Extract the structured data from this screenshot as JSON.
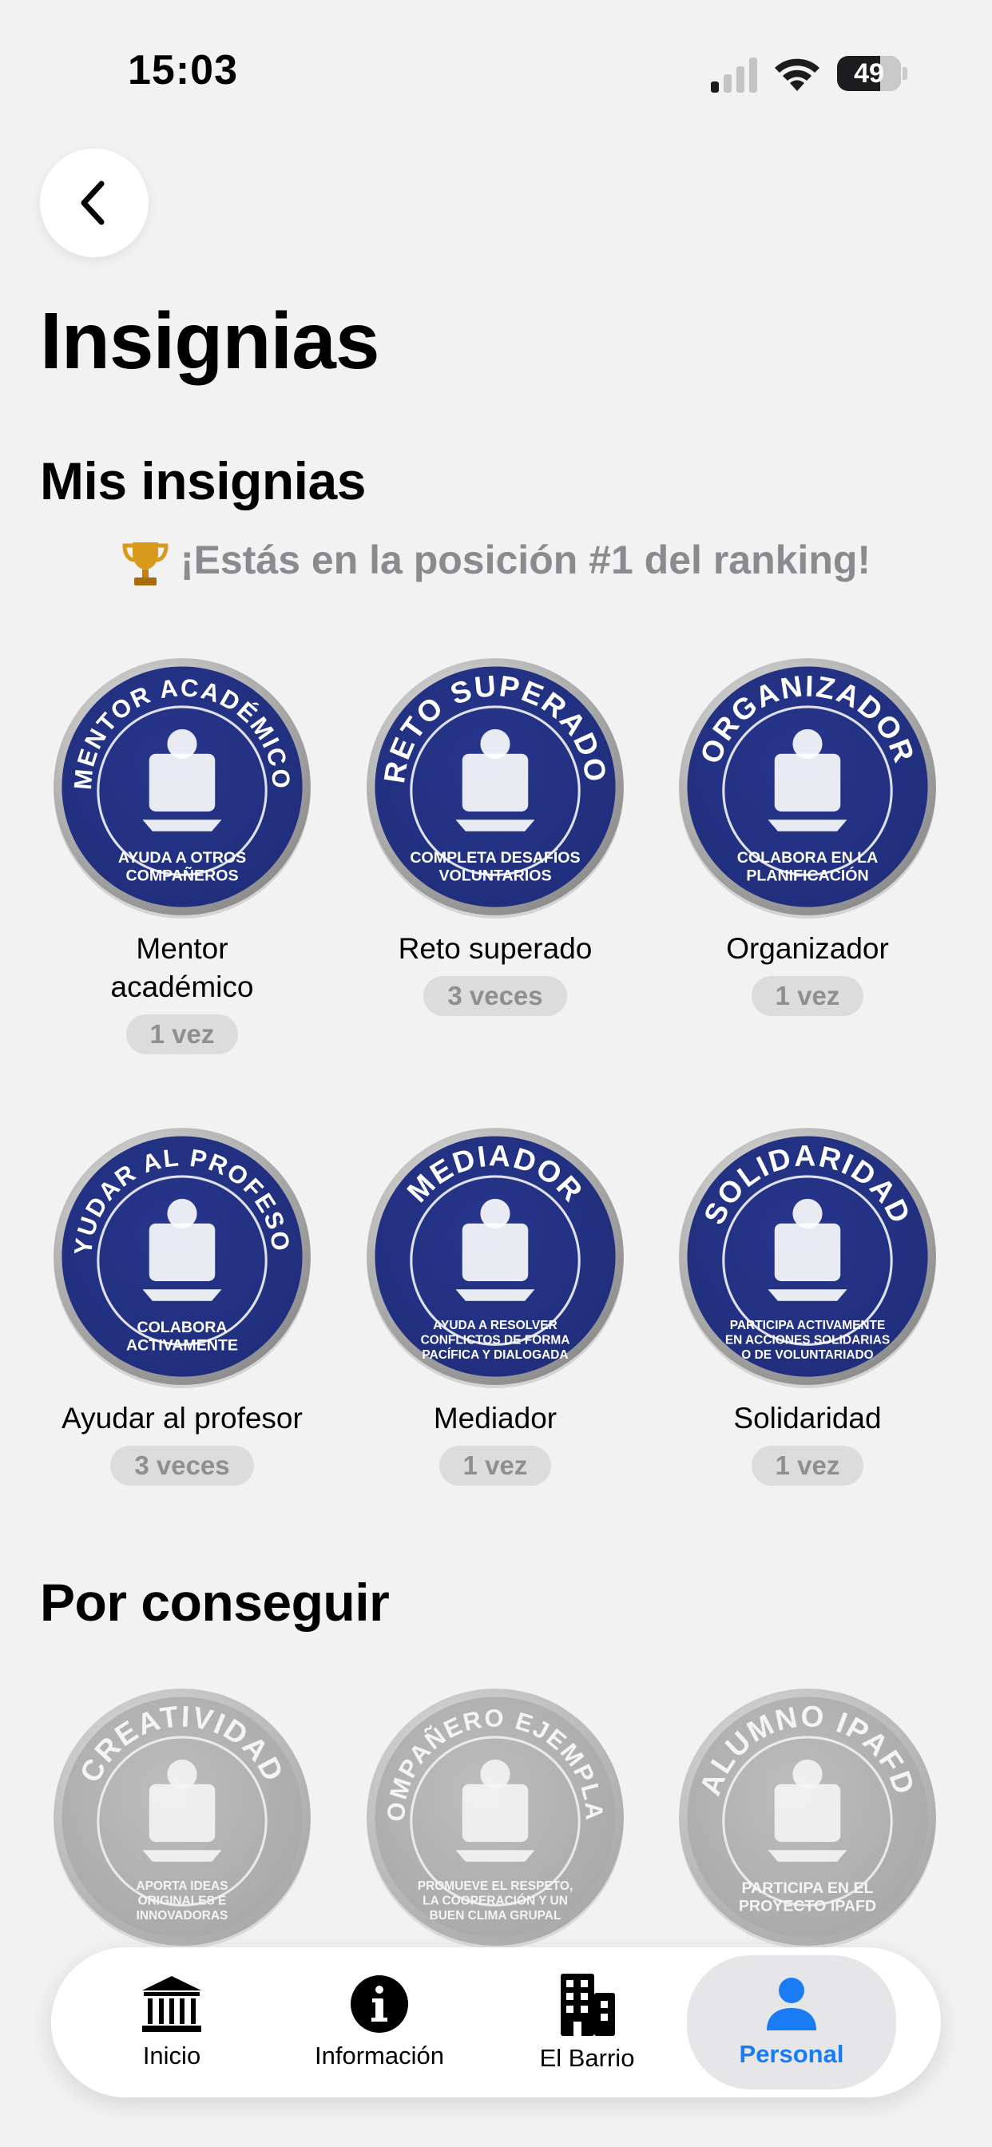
{
  "status_bar": {
    "time": "15:03",
    "battery": "49"
  },
  "header": {
    "title": "Insignias"
  },
  "mine": {
    "title": "Mis insignias",
    "ranking": "¡Estás en la posición #1 del ranking!",
    "badges": [
      {
        "name": "Mentor académico",
        "count": "1 vez",
        "ring_top": "MENTOR ACADÉMICO",
        "ring_bottom": [
          "AYUDA A OTROS",
          "COMPAÑEROS"
        ]
      },
      {
        "name": "Reto superado",
        "count": "3 veces",
        "ring_top": "RETO SUPERADO",
        "ring_bottom": [
          "COMPLETA DESAFÍOS",
          "VOLUNTARIOS"
        ]
      },
      {
        "name": "Organizador",
        "count": "1 vez",
        "ring_top": "ORGANIZADOR",
        "ring_bottom": [
          "COLABORA EN LA",
          "PLANIFICACIÓN"
        ]
      },
      {
        "name": "Ayudar al profesor",
        "count": "3 veces",
        "ring_top": "AYUDAR AL PROFESOR",
        "ring_bottom": [
          "COLABORA",
          "ACTIVAMENTE"
        ]
      },
      {
        "name": "Mediador",
        "count": "1 vez",
        "ring_top": "MEDIADOR",
        "ring_bottom": [
          "AYUDA A RESOLVER",
          "CONFLICTOS DE FORMA",
          "PACÍFICA Y DIALOGADA"
        ]
      },
      {
        "name": "Solidaridad",
        "count": "1 vez",
        "ring_top": "SOLIDARIDAD",
        "ring_bottom": [
          "PARTICIPA ACTIVAMENTE",
          "EN ACCIONES SOLIDARIAS",
          "O DE VOLUNTARIADO"
        ]
      }
    ]
  },
  "pending": {
    "title": "Por conseguir",
    "badges": [
      {
        "ring_top": "CREATIVIDAD",
        "ring_bottom": [
          "APORTA IDEAS",
          "ORIGINALES E",
          "INNOVADORAS"
        ]
      },
      {
        "ring_top": "COMPAÑERO EJEMPLAR",
        "ring_bottom": [
          "PROMUEVE EL RESPETO,",
          "LA COOPERACIÓN Y UN",
          "BUEN CLIMA GRUPAL"
        ]
      },
      {
        "ring_top": "ALUMNO IPAFD",
        "ring_bottom": [
          "PARTICIPA EN EL",
          "PROYECTO IPAFD"
        ]
      }
    ]
  },
  "tabbar": {
    "items": [
      {
        "label": "Inicio",
        "icon": "bank-icon"
      },
      {
        "label": "Información",
        "icon": "info-icon"
      },
      {
        "label": "El Barrio",
        "icon": "building-icon"
      },
      {
        "label": "Personal",
        "icon": "person-icon"
      }
    ],
    "active": "Personal",
    "active_color": "#1a7cf5"
  },
  "colors": {
    "badge_blue": "#1f2d7a",
    "badge_silver": "#b9b9b9",
    "background": "#f2f2f2"
  }
}
